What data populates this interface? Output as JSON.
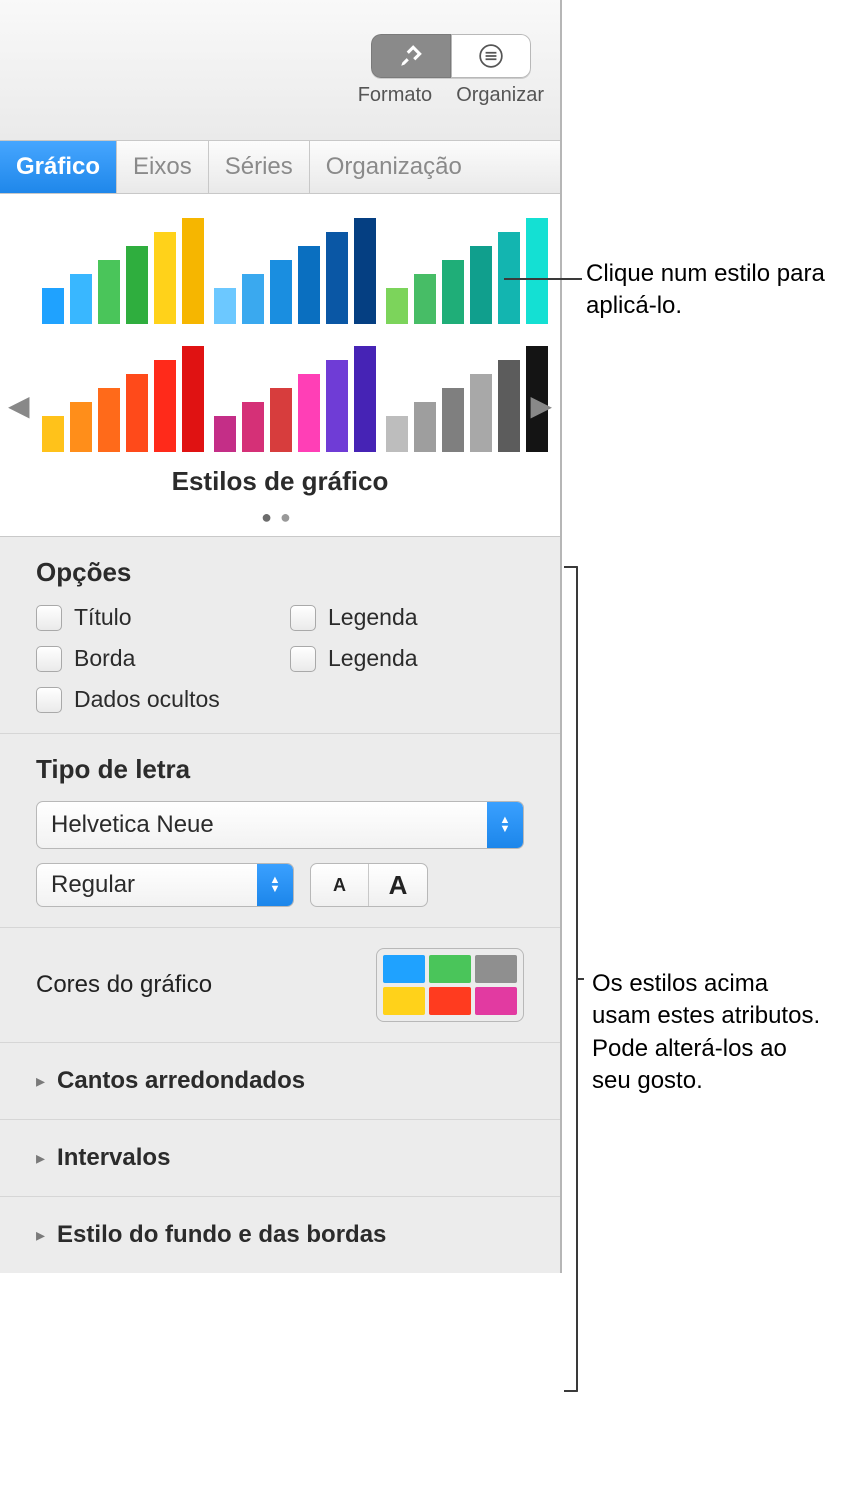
{
  "toolbar": {
    "format_label": "Formato",
    "organize_label": "Organizar"
  },
  "tabs": {
    "chart": "Gráfico",
    "axes": "Eixos",
    "series": "Séries",
    "arrange": "Organização"
  },
  "styles": {
    "title": "Estilos de gráfico",
    "palettes": [
      [
        "#1fa2ff",
        "#39b7ff",
        "#4ac55a",
        "#2fae3e",
        "#ffd21a",
        "#f6b600"
      ],
      [
        "#6cc8ff",
        "#3aa9ef",
        "#1a8ee0",
        "#0a6fc0",
        "#0a57a5",
        "#053f82"
      ],
      [
        "#7cd45b",
        "#47bd66",
        "#1fae78",
        "#109f8d",
        "#13b5b0",
        "#14e0d3"
      ],
      [
        "#ffc21a",
        "#ff8e1a",
        "#ff6a1a",
        "#ff4a1a",
        "#ff2a1a",
        "#e01212"
      ],
      [
        "#c42e87",
        "#d53077",
        "#d73d3d",
        "#ff3fb6",
        "#6f3cd6",
        "#4623b5"
      ],
      [
        "#bdbdbd",
        "#9e9e9e",
        "#7f7f7f",
        "#a8a8a8",
        "#5c5c5c",
        "#141414"
      ]
    ]
  },
  "options": {
    "header": "Opções",
    "title": "Título",
    "border": "Borda",
    "hidden": "Dados ocultos",
    "legend1": "Legenda",
    "legend2": "Legenda"
  },
  "font": {
    "header": "Tipo de letra",
    "family": "Helvetica Neue",
    "weight": "Regular"
  },
  "colors": {
    "label": "Cores do gráfico",
    "swatches": [
      "#1fa2ff",
      "#4ac55a",
      "#8f8f8f",
      "#ffd21a",
      "#ff3b1f",
      "#e23aa1"
    ]
  },
  "disclosure": {
    "rounded": "Cantos arredondados",
    "intervals": "Intervalos",
    "bg": "Estilo do fundo e das bordas"
  },
  "callouts": {
    "styles": "Clique num estilo para aplicá-lo.",
    "attrs": "Os estilos acima usam estes atributos. Pode alterá-los ao seu gosto."
  }
}
